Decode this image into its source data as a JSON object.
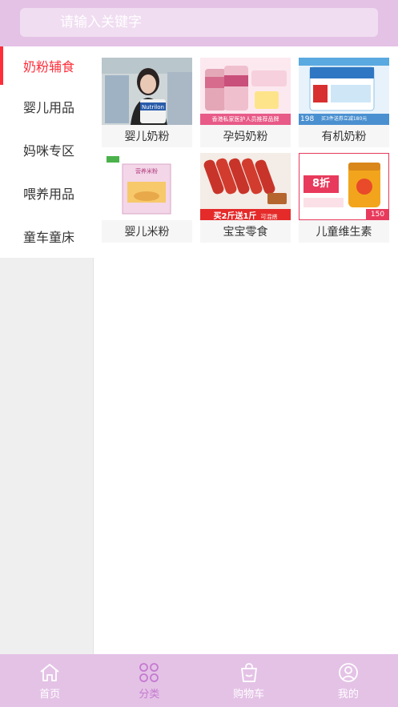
{
  "header": {
    "search_placeholder": "请输入关键字"
  },
  "sidebar": {
    "items": [
      {
        "label": "奶粉辅食",
        "active": true
      },
      {
        "label": "婴儿用品",
        "active": false
      },
      {
        "label": "妈咪专区",
        "active": false
      },
      {
        "label": "喂养用品",
        "active": false
      },
      {
        "label": "童车童床",
        "active": false
      }
    ]
  },
  "grid": {
    "items": [
      {
        "label": "婴儿奶粉",
        "image": "baby-formula-photo"
      },
      {
        "label": "孕妈奶粉",
        "image": "maternal-formula-photo",
        "banner": "香港私家医护人员推荐品牌"
      },
      {
        "label": "有机奶粉",
        "image": "organic-formula-photo",
        "price": "198",
        "promo": "买3件送券立减180元"
      },
      {
        "label": "婴儿米粉",
        "image": "rice-cereal-photo",
        "pack_title": "营养米粉"
      },
      {
        "label": "宝宝零食",
        "image": "snack-photo",
        "banner": "买2斤送1斤",
        "banner_small": "可混搭"
      },
      {
        "label": "儿童维生素",
        "image": "vitamin-photo",
        "discount": "8折",
        "price": "150"
      }
    ]
  },
  "tabbar": {
    "tabs": [
      {
        "label": "首页",
        "icon": "home-icon",
        "active": false
      },
      {
        "label": "分类",
        "icon": "category-icon",
        "active": true
      },
      {
        "label": "购物车",
        "icon": "cart-icon",
        "active": false
      },
      {
        "label": "我的",
        "icon": "user-icon",
        "active": false
      }
    ]
  },
  "colors": {
    "theme": "#e4c2e6",
    "accent_red": "#ff2d3a",
    "tab_active": "#c57ad0"
  }
}
